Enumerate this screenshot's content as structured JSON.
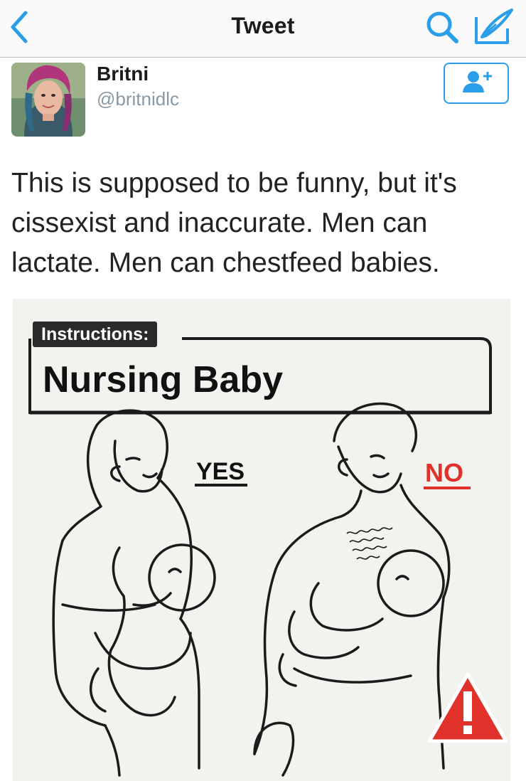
{
  "nav": {
    "title": "Tweet"
  },
  "tweet": {
    "author_name": "Britni",
    "author_handle": "@britnidlc",
    "text": "This is supposed to be funny, but it's cissexist and inaccurate. Men can lactate. Men can chestfeed babies."
  },
  "image": {
    "tag": "Instructions:",
    "heading": "Nursing Baby",
    "yes_label": "YES",
    "no_label": "NO",
    "warning_glyph": "!"
  },
  "colors": {
    "accent": "#2a9ee8",
    "warning": "#e0322b"
  },
  "icons": [
    "back-chevron-icon",
    "search-icon",
    "compose-icon",
    "follow-user-icon",
    "warning-icon"
  ]
}
